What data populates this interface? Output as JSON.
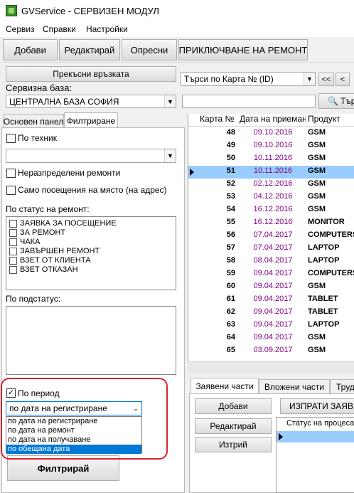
{
  "window": {
    "title": "GVService - СЕРВИЗЕН МОДУЛ"
  },
  "menu": [
    "Сервиз",
    "Справки",
    "Настройки"
  ],
  "toolbar": {
    "add": "Добави",
    "edit": "Редактирай",
    "refresh": "Опресни",
    "finish": "ПРИКЛЮЧВАНЕ НА РЕМОНТ"
  },
  "top": {
    "disconnect": "Прекъсни връзката",
    "base_label": "Сервизна база:",
    "base_value": "ЦЕНТРАЛНА БАЗА СОФИЯ",
    "search_mode": "Търси по Карта № (ID)",
    "nav_first": "<<",
    "nav_prev": "<",
    "search_button": "Тър",
    "search_value": ""
  },
  "left_tabs": [
    "Основен панел",
    "Филтриране"
  ],
  "filter": {
    "by_technician": "По техник",
    "unassigned": "Неразпределени ремонти",
    "onsite_only": "Само посещения на място (на адрес)",
    "by_status_label": "По статус на ремонт:",
    "statuses": [
      "ЗАЯВКА ЗА ПОСЕЩЕНИЕ",
      "ЗА РЕМОНТ",
      "ЧАКА",
      "ЗАВЪРШЕН РЕМОНТ",
      "ВЗЕТ ОТ КЛИЕНТА",
      "ВЗЕТ ОТКАЗАН"
    ],
    "by_substatus_label": "По подстатус:",
    "by_period": "По период",
    "period_checked": true,
    "period_selected": "по дата на регистриране",
    "period_options": [
      "по дата на регистриране",
      "по дата на ремонт",
      "по дата на получаване",
      "по обещана дата"
    ],
    "period_highlighted_index": 3,
    "filter_button": "Филтрирай"
  },
  "table": {
    "columns": [
      "Карта №",
      "Дата на приемане",
      "Продукт"
    ],
    "rows": [
      {
        "id": "48",
        "date": "09.10.2016",
        "product": "GSM"
      },
      {
        "id": "49",
        "date": "09.10.2016",
        "product": "GSM"
      },
      {
        "id": "50",
        "date": "10.11.2016",
        "product": "GSM"
      },
      {
        "id": "51",
        "date": "10.11.2016",
        "product": "GSM"
      },
      {
        "id": "52",
        "date": "02.12.2016",
        "product": "GSM"
      },
      {
        "id": "53",
        "date": "04.12.2016",
        "product": "GSM"
      },
      {
        "id": "54",
        "date": "16.12.2016",
        "product": "GSM"
      },
      {
        "id": "55",
        "date": "16.12.2016",
        "product": "MONITOR"
      },
      {
        "id": "56",
        "date": "07.04.2017",
        "product": "COMPUTERS"
      },
      {
        "id": "57",
        "date": "07.04.2017",
        "product": "LAPTOP"
      },
      {
        "id": "58",
        "date": "08.04.2017",
        "product": "LAPTOP"
      },
      {
        "id": "59",
        "date": "09.04.2017",
        "product": "COMPUTERS"
      },
      {
        "id": "60",
        "date": "09.04.2017",
        "product": "GSM"
      },
      {
        "id": "61",
        "date": "09.04.2017",
        "product": "TABLET"
      },
      {
        "id": "62",
        "date": "09.04.2017",
        "product": "TABLET"
      },
      {
        "id": "63",
        "date": "09.04.2017",
        "product": "LAPTOP"
      },
      {
        "id": "64",
        "date": "09.04.2017",
        "product": "GSM"
      },
      {
        "id": "65",
        "date": "03.09.2017",
        "product": "GSM"
      }
    ],
    "selected_index": 3
  },
  "bottom_tabs": [
    "Заявени части",
    "Вложени части",
    "Труд"
  ],
  "parts": {
    "add": "Добави",
    "edit": "Редактирай",
    "delete": "Изтрий",
    "send_request": "ИЗПРАТИ ЗАЯВКА",
    "status_column": "Статус на процеса"
  },
  "colors": {
    "selection": "#99ccff",
    "date_text": "#800080",
    "dropdown_highlight": "#0078d7",
    "annotation_ring": "#d9232e"
  }
}
